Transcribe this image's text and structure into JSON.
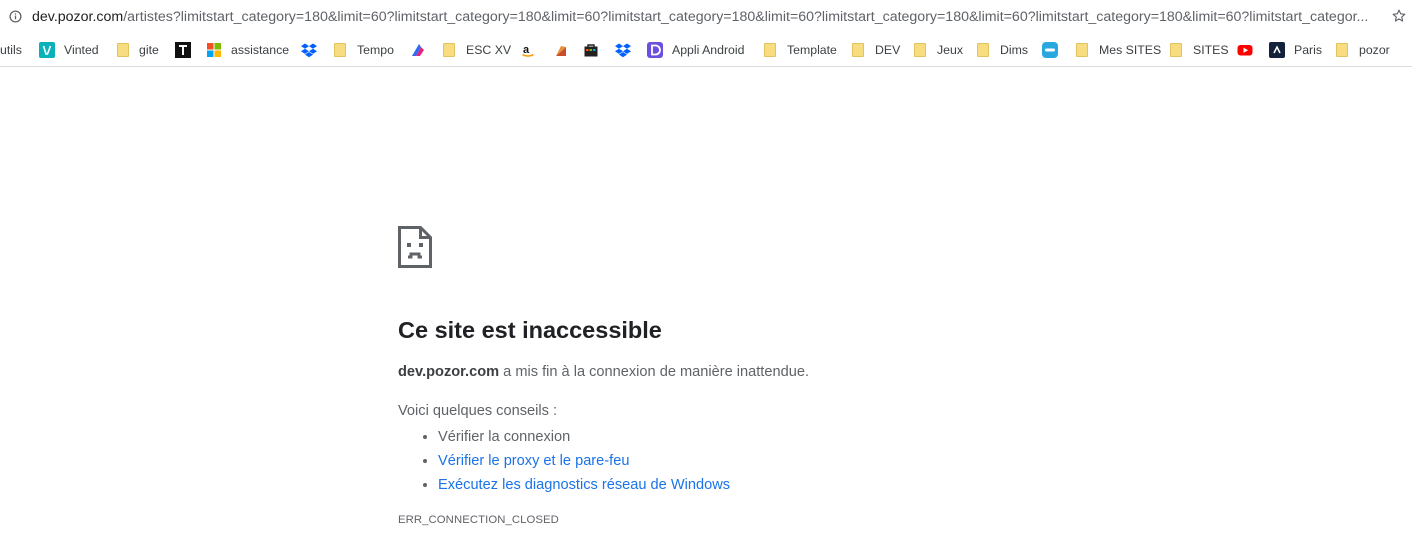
{
  "address_bar": {
    "host": "dev.pozor.com",
    "path": "/artistes?limitstart_category=180&limit=60?limitstart_category=180&limit=60?limitstart_category=180&limit=60?limitstart_category=180&limit=60?limitstart_category=180&limit=60?limitstart_categor...",
    "left_icon": "info-icon",
    "right_icon": "star-icon"
  },
  "bookmarks": [
    {
      "label": "utils",
      "icon": "none"
    },
    {
      "label": "Vinted",
      "icon": "vinted-icon"
    },
    {
      "label": "gite",
      "icon": "folder-icon"
    },
    {
      "label": "",
      "icon": "t-logo-icon"
    },
    {
      "label": "assistance",
      "icon": "microsoft-icon"
    },
    {
      "label": "",
      "icon": "dropbox-icon"
    },
    {
      "label": "Tempo",
      "icon": "folder-icon"
    },
    {
      "label": "",
      "icon": "arrow-logo-icon"
    },
    {
      "label": "ESC XV",
      "icon": "folder-icon"
    },
    {
      "label": "",
      "icon": "amazon-icon"
    },
    {
      "label": "",
      "icon": "red-square-icon"
    },
    {
      "label": "",
      "icon": "bag-icon"
    },
    {
      "label": "",
      "icon": "dropbox-icon"
    },
    {
      "label": "Appli Android",
      "icon": "purple-d-icon"
    },
    {
      "label": "Template",
      "icon": "folder-icon"
    },
    {
      "label": "DEV",
      "icon": "folder-icon"
    },
    {
      "label": "Jeux",
      "icon": "folder-icon"
    },
    {
      "label": "Dims",
      "icon": "folder-icon"
    },
    {
      "label": "",
      "icon": "blue-app-icon"
    },
    {
      "label": "Mes SITES",
      "icon": "folder-icon"
    },
    {
      "label": "SITES",
      "icon": "folder-icon"
    },
    {
      "label": "",
      "icon": "youtube-icon"
    },
    {
      "label": "Paris",
      "icon": "dark-logo-icon"
    },
    {
      "label": "pozor",
      "icon": "folder-icon"
    }
  ],
  "error": {
    "icon": "sad-page-icon",
    "title": "Ce site est inaccessible",
    "host": "dev.pozor.com",
    "description": " a mis fin à la connexion de manière inattendue.",
    "suggestions_heading": "Voici quelques conseils :",
    "suggestions": [
      "Vérifier la connexion",
      "Vérifier le proxy et le pare-feu",
      "Exécutez les diagnostics réseau de Windows"
    ],
    "code": "ERR_CONNECTION_CLOSED"
  },
  "colors": {
    "link": "#1a73e8",
    "text_secondary": "#5f6368",
    "folder": "#f8dd80"
  }
}
